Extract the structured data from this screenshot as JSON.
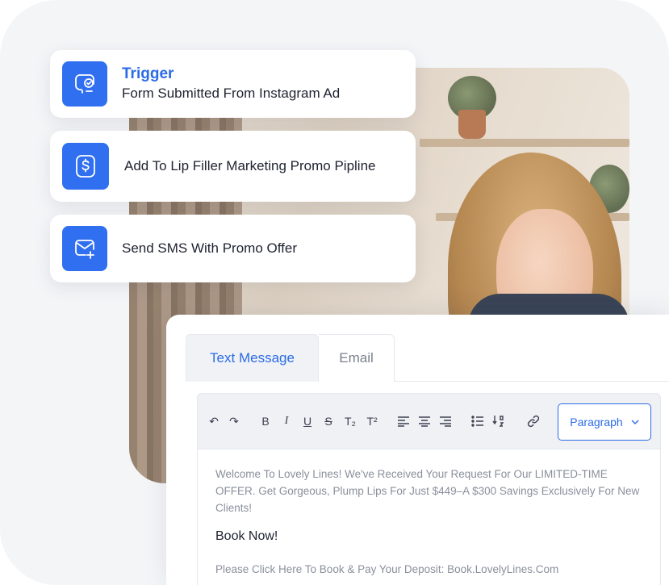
{
  "workflow": {
    "trigger": {
      "title": "Trigger",
      "text": "Form Submitted From Instagram Ad",
      "icon": "form-check-icon"
    },
    "step_2": {
      "text": "Add To Lip Filler Marketing Promo Pipline",
      "icon": "dollar-icon"
    },
    "step_3": {
      "text": "Send SMS With Promo Offer",
      "icon": "mail-plus-icon"
    }
  },
  "editor": {
    "tabs": [
      {
        "label": "Text Message",
        "active": true
      },
      {
        "label": "Email",
        "active": false
      }
    ],
    "toolbar": {
      "undo_icon": "↶",
      "redo_icon": "↷",
      "bold": "B",
      "italic": "I",
      "underline": "U",
      "strike": "S",
      "subscript": "T₂",
      "superscript": "T²",
      "paragraph_select": "Paragraph"
    },
    "message": "Welcome To Lovely Lines! We've Received Your Request For Our LIMITED-TIME OFFER. Get Gorgeous, Plump Lips For Just $449–A $300 Savings Exclusively For New Clients!",
    "cta": "Book Now!",
    "deposit": "Please Click Here To Book & Pay Your Deposit: Book.LovelyLines.Com"
  },
  "colors": {
    "accent": "#2f6ff0",
    "link": "#2b6be6",
    "background": "#f4f5f7"
  }
}
